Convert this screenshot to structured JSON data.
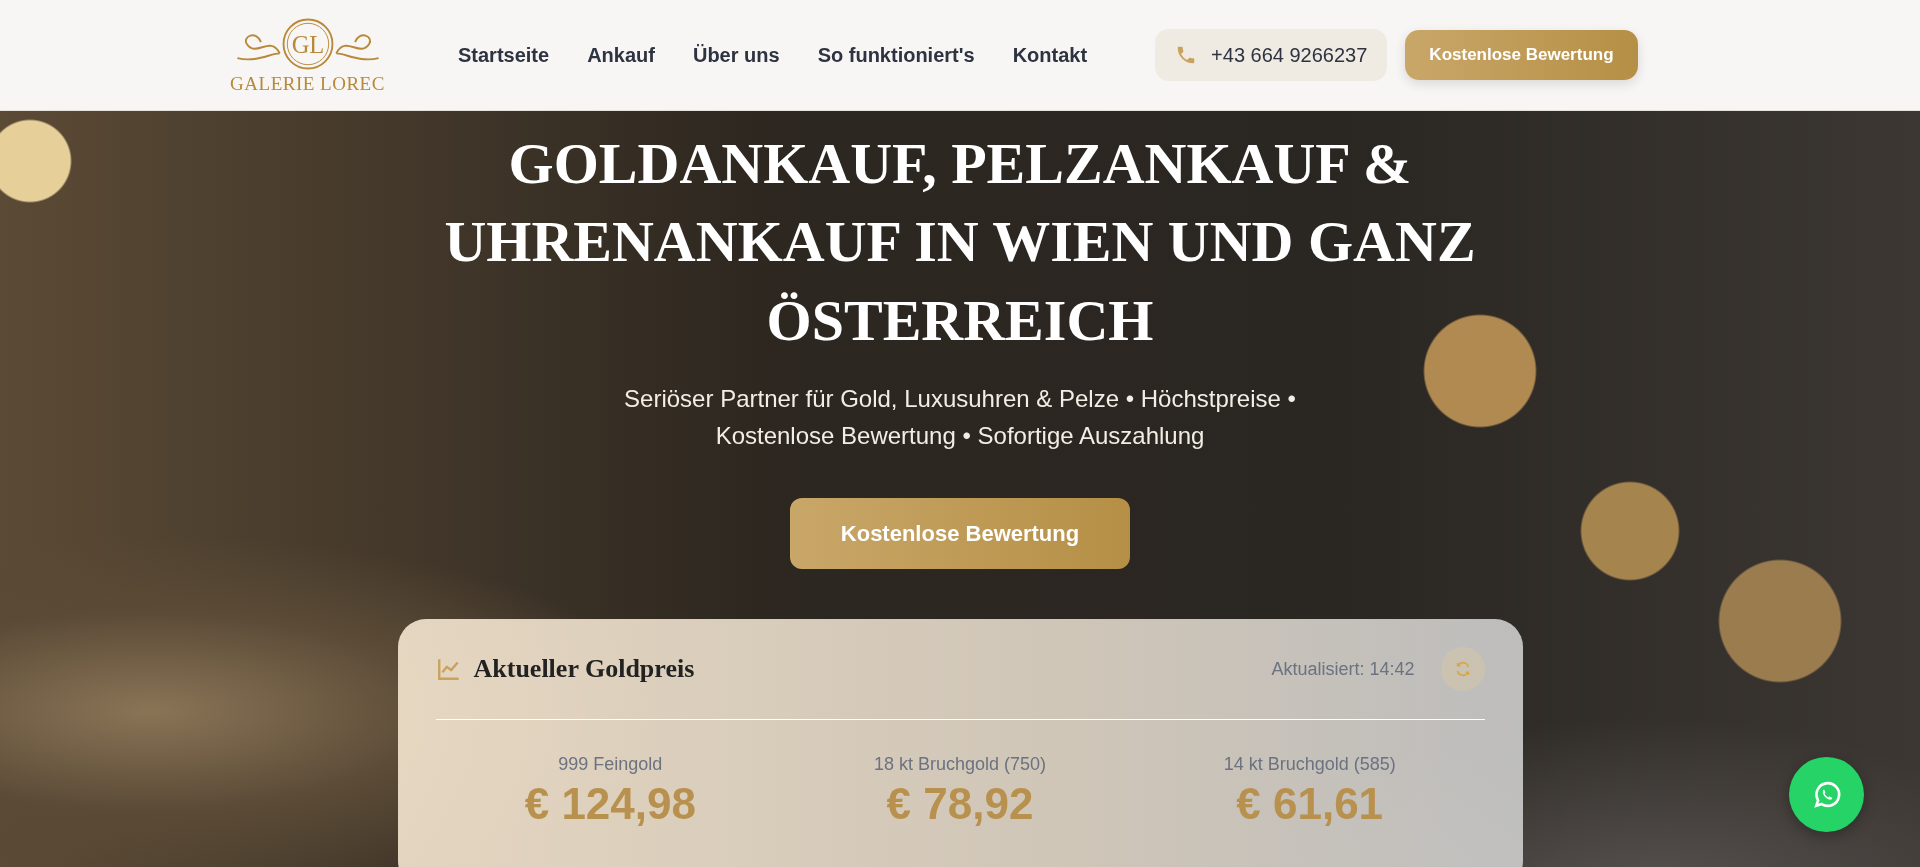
{
  "header": {
    "logo": {
      "monogram": "GL",
      "name": "GALERIE LOREC"
    },
    "nav": [
      {
        "label": "Startseite"
      },
      {
        "label": "Ankauf"
      },
      {
        "label": "Über uns"
      },
      {
        "label": "So funktioniert's"
      },
      {
        "label": "Kontakt"
      }
    ],
    "phone": "+43 664 9266237",
    "cta": "Kostenlose Bewertung"
  },
  "hero": {
    "title": "GOLDANKAUF, PELZANKAUF & UHRENANKAUF IN WIEN UND GANZ ÖSTERREICH",
    "subtitle": "Seriöser Partner für Gold, Luxusuhren & Pelze • Höchstpreise • Kostenlose Bewertung • Sofortige Auszahlung",
    "cta": "Kostenlose Bewertung"
  },
  "gold_price": {
    "title": "Aktueller Goldpreis",
    "updated": "Aktualisiert: 14:42",
    "prices": [
      {
        "label": "999 Feingold",
        "value": "€ 124,98"
      },
      {
        "label": "18 kt Bruchgold (750)",
        "value": "€ 78,92"
      },
      {
        "label": "14 kt Bruchgold (585)",
        "value": "€ 61,61"
      }
    ]
  }
}
